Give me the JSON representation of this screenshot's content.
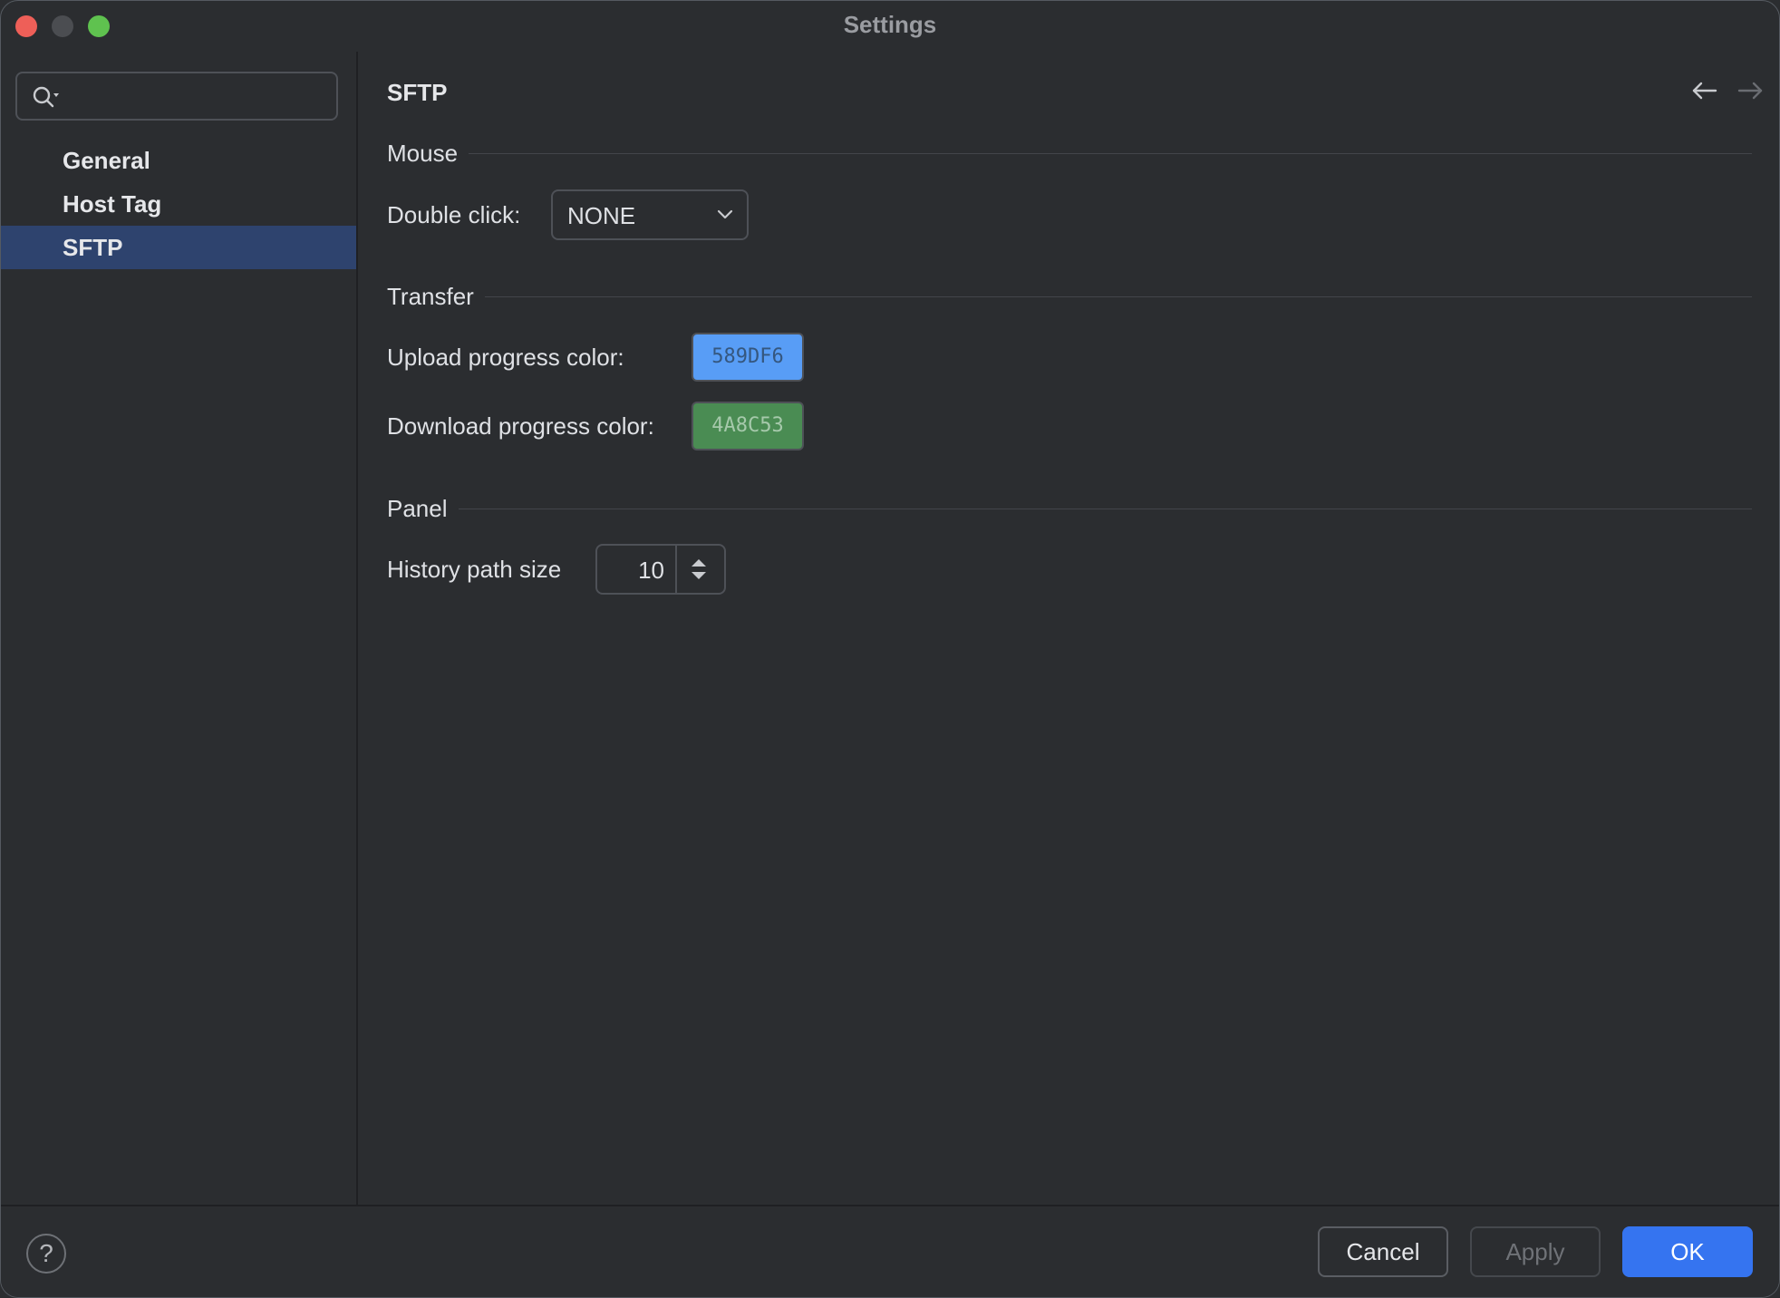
{
  "window": {
    "title": "Settings"
  },
  "sidebar": {
    "search": {
      "value": "",
      "placeholder": "",
      "icon": "search-icon"
    },
    "items": [
      {
        "label": "General",
        "selected": false
      },
      {
        "label": "Host Tag",
        "selected": false
      },
      {
        "label": "SFTP",
        "selected": true
      }
    ]
  },
  "main": {
    "title": "SFTP",
    "sections": {
      "mouse": {
        "label": "Mouse",
        "double_click_label": "Double click:",
        "double_click_value": "NONE"
      },
      "transfer": {
        "label": "Transfer",
        "upload_label": "Upload progress color:",
        "upload_color": "589DF6",
        "upload_color_hex": "#589DF6",
        "download_label": "Download progress color:",
        "download_color": "4A8C53",
        "download_color_hex": "#4A8C53"
      },
      "panel": {
        "label": "Panel",
        "history_label": "History path size",
        "history_value": "10"
      }
    }
  },
  "footer": {
    "help_label": "?",
    "cancel_label": "Cancel",
    "apply_label": "Apply",
    "ok_label": "OK"
  },
  "colors": {
    "accent": "#3574F0",
    "selection": "#2E436E",
    "background": "#2B2D30"
  }
}
